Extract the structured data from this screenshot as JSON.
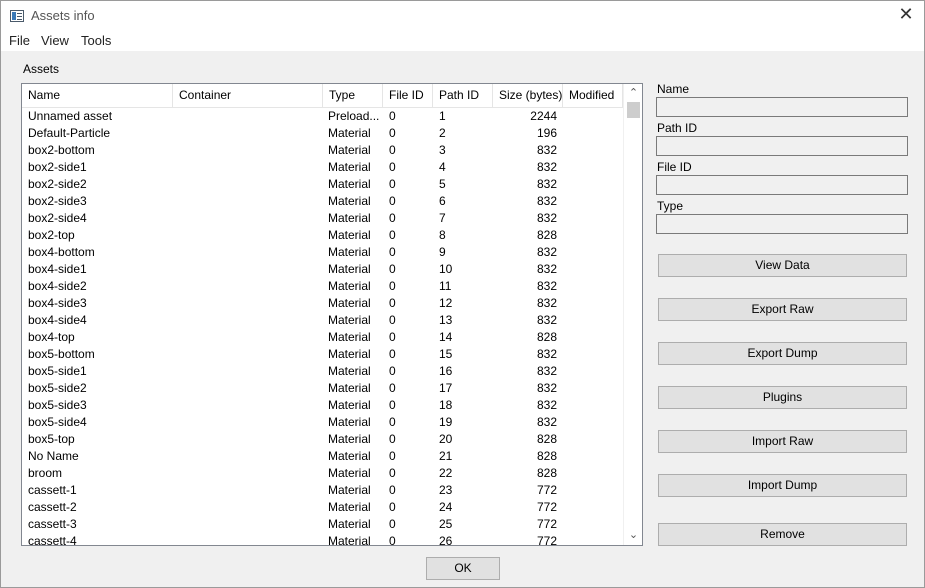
{
  "window": {
    "title": "Assets info"
  },
  "menu": [
    "File",
    "View",
    "Tools"
  ],
  "group_label": "Assets",
  "table": {
    "columns": [
      "Name",
      "Container",
      "Type",
      "File ID",
      "Path ID",
      "Size (bytes)",
      "Modified"
    ],
    "rows": [
      [
        "Unnamed asset",
        "",
        "Preload...",
        "0",
        "1",
        "2244",
        ""
      ],
      [
        "Default-Particle",
        "",
        "Material",
        "0",
        "2",
        "196",
        ""
      ],
      [
        "box2-bottom",
        "",
        "Material",
        "0",
        "3",
        "832",
        ""
      ],
      [
        "box2-side1",
        "",
        "Material",
        "0",
        "4",
        "832",
        ""
      ],
      [
        "box2-side2",
        "",
        "Material",
        "0",
        "5",
        "832",
        ""
      ],
      [
        "box2-side3",
        "",
        "Material",
        "0",
        "6",
        "832",
        ""
      ],
      [
        "box2-side4",
        "",
        "Material",
        "0",
        "7",
        "832",
        ""
      ],
      [
        "box2-top",
        "",
        "Material",
        "0",
        "8",
        "828",
        ""
      ],
      [
        "box4-bottom",
        "",
        "Material",
        "0",
        "9",
        "832",
        ""
      ],
      [
        "box4-side1",
        "",
        "Material",
        "0",
        "10",
        "832",
        ""
      ],
      [
        "box4-side2",
        "",
        "Material",
        "0",
        "11",
        "832",
        ""
      ],
      [
        "box4-side3",
        "",
        "Material",
        "0",
        "12",
        "832",
        ""
      ],
      [
        "box4-side4",
        "",
        "Material",
        "0",
        "13",
        "832",
        ""
      ],
      [
        "box4-top",
        "",
        "Material",
        "0",
        "14",
        "828",
        ""
      ],
      [
        "box5-bottom",
        "",
        "Material",
        "0",
        "15",
        "832",
        ""
      ],
      [
        "box5-side1",
        "",
        "Material",
        "0",
        "16",
        "832",
        ""
      ],
      [
        "box5-side2",
        "",
        "Material",
        "0",
        "17",
        "832",
        ""
      ],
      [
        "box5-side3",
        "",
        "Material",
        "0",
        "18",
        "832",
        ""
      ],
      [
        "box5-side4",
        "",
        "Material",
        "0",
        "19",
        "832",
        ""
      ],
      [
        "box5-top",
        "",
        "Material",
        "0",
        "20",
        "828",
        ""
      ],
      [
        "No Name",
        "",
        "Material",
        "0",
        "21",
        "828",
        ""
      ],
      [
        "broom",
        "",
        "Material",
        "0",
        "22",
        "828",
        ""
      ],
      [
        "cassett-1",
        "",
        "Material",
        "0",
        "23",
        "772",
        ""
      ],
      [
        "cassett-2",
        "",
        "Material",
        "0",
        "24",
        "772",
        ""
      ],
      [
        "cassett-3",
        "",
        "Material",
        "0",
        "25",
        "772",
        ""
      ],
      [
        "cassett-4",
        "",
        "Material",
        "0",
        "26",
        "772",
        ""
      ]
    ]
  },
  "fields": {
    "name": {
      "label": "Name",
      "value": ""
    },
    "path_id": {
      "label": "Path ID",
      "value": ""
    },
    "file_id": {
      "label": "File ID",
      "value": ""
    },
    "type": {
      "label": "Type",
      "value": ""
    }
  },
  "buttons": {
    "view_data": "View Data",
    "export_raw": "Export Raw",
    "export_dump": "Export Dump",
    "plugins": "Plugins",
    "import_raw": "Import Raw",
    "import_dump": "Import Dump",
    "remove": "Remove",
    "ok": "OK"
  },
  "icons": {
    "close": "close-icon",
    "scroll_up": "chevron-up-icon",
    "scroll_down": "chevron-down-icon",
    "app": "app-window-icon"
  }
}
